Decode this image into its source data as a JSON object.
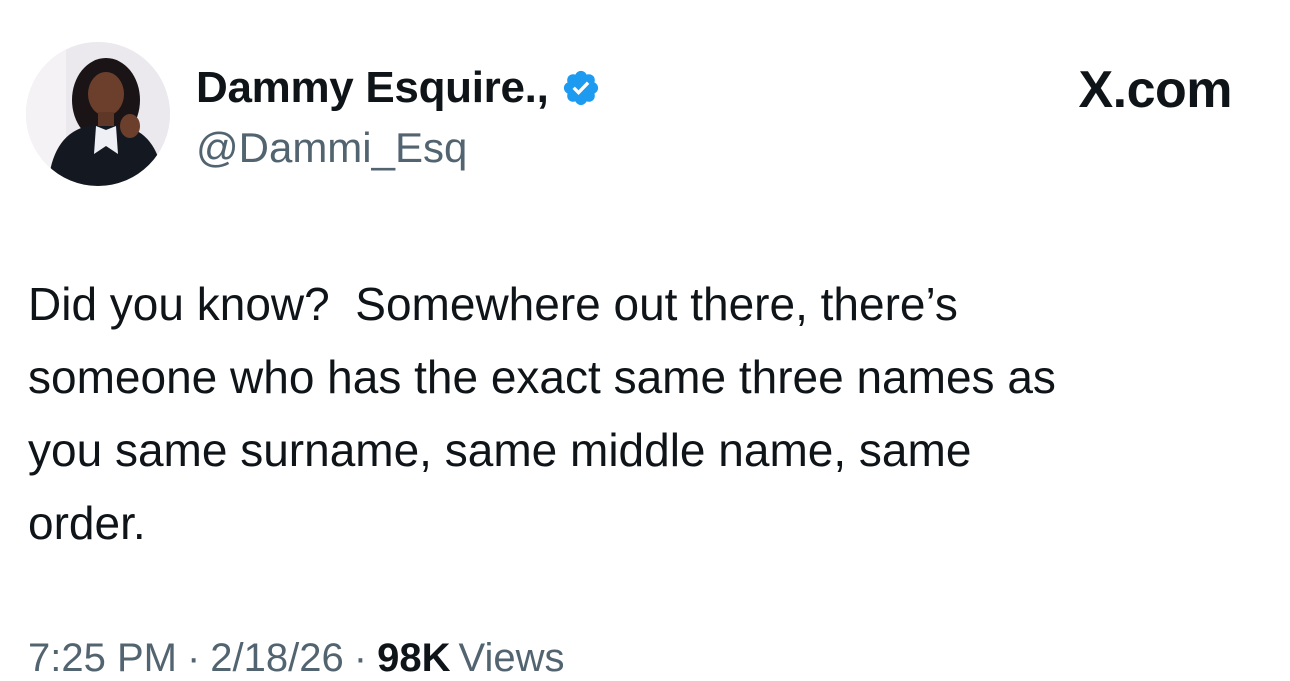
{
  "author": {
    "display_name": "Dammy Esquire.,",
    "handle": "@Dammi_Esq",
    "verified": true
  },
  "brand": "X.com",
  "tweet": {
    "text": "Did you know?  Somewhere out there, there’s\nsomeone who has the exact same three names as\nyou same surname, same middle name, same\norder."
  },
  "meta": {
    "time": "7:25 PM",
    "separator": "·",
    "date": "2/18/26",
    "views_count": "98K",
    "views_label": "Views"
  },
  "colors": {
    "verified": "#1d9bf0",
    "secondary_text": "#536471",
    "primary_text": "#0f1419"
  },
  "icons": {
    "verified": "verified-badge-icon"
  }
}
